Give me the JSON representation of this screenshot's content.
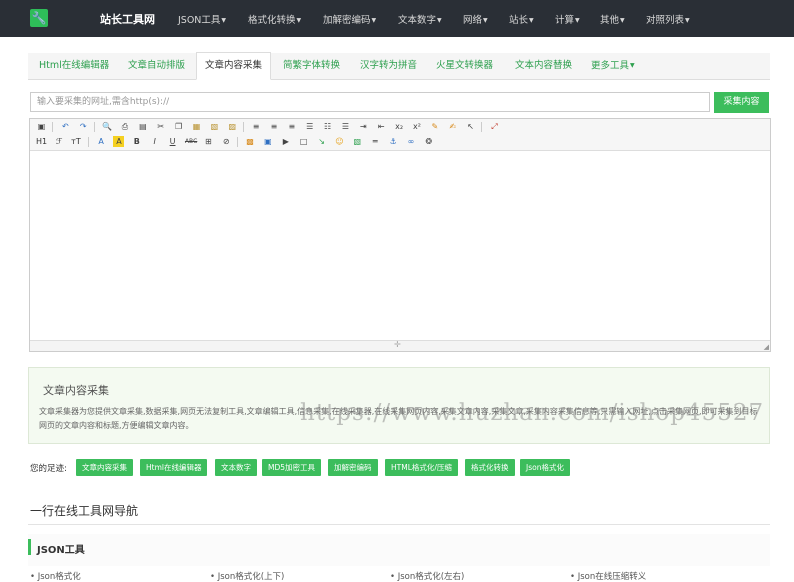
{
  "nav": {
    "site_name": "站长工具网",
    "items": [
      "JSON工具",
      "格式化转换",
      "加解密编码",
      "文本数字",
      "网络",
      "站长",
      "计算",
      "其他",
      "对照列表"
    ]
  },
  "tabs": [
    "Html在线编辑器",
    "文章自动排版",
    "文章内容采集",
    "简繁字体转换",
    "汉字转为拼音",
    "火星文转换器",
    "文本内容替换",
    "更多工具"
  ],
  "url_input": {
    "placeholder": "输入要采集的网址,需含http(s)://"
  },
  "collect_button": "采集内容",
  "toolbar": {
    "heading": "H1",
    "font": "ℱ",
    "size": "тT"
  },
  "info": {
    "title": "文章内容采集",
    "description": "文章采集器为您提供文章采集,数据采集,网页无法复制工具,文章编辑工具,信息采集,在线采集器,在线采集网页内容,采集文章内容,采集文章,采集内容采集信息等,只需输入网址,点击采集网页,即可采集到目标网页的文章内容和标题,方便编辑文章内容。"
  },
  "watermark": "https://www.huzhan.com/ishop45527",
  "footprint": {
    "label": "您的足迹:",
    "items": [
      "文章内容采集",
      "Html在线编辑器",
      "文本数字",
      "MD5加密工具",
      "加解密编码",
      "HTML格式化/压缩",
      "格式化转换",
      "Json格式化"
    ]
  },
  "nav_section": {
    "title": "一行在线工具网导航",
    "category": "JSON工具",
    "links": [
      "Json格式化",
      "Json格式化(上下)",
      "Json格式化(左右)",
      "Json在线压缩转义"
    ]
  },
  "colors": {
    "accent": "#3cbd5c",
    "nav_bg": "#2a2f36"
  }
}
